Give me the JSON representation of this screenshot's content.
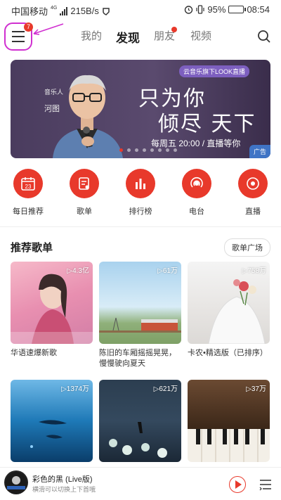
{
  "status_bar": {
    "carrier": "中国移动",
    "network": "4G",
    "speed": "215B/s",
    "battery": "95%",
    "time": "08:54"
  },
  "top_nav": {
    "menu_badge": "7",
    "tabs": [
      {
        "label": "我的"
      },
      {
        "label": "发现"
      },
      {
        "label": "朋友"
      },
      {
        "label": "视频"
      }
    ]
  },
  "banner": {
    "tag": "云音乐旗下LOOK直播",
    "host_role": "音乐人",
    "host_name": "河图",
    "line1": "只为你",
    "line2": "倾尽 天下",
    "schedule": "每周五 20:00 / 直播等你",
    "ad_label": "广告"
  },
  "categories": [
    {
      "label": "每日推荐",
      "icon": "calendar-icon",
      "day": "23"
    },
    {
      "label": "歌单",
      "icon": "playlist-icon"
    },
    {
      "label": "排行榜",
      "icon": "chart-icon"
    },
    {
      "label": "电台",
      "icon": "radio-icon"
    },
    {
      "label": "直播",
      "icon": "live-icon"
    }
  ],
  "recommend": {
    "title": "推荐歌单",
    "more_label": "歌单广场",
    "playlists": [
      {
        "plays": "▷4.3亿",
        "title": "华语速爆新歌"
      },
      {
        "plays": "▷61万",
        "title": "陈旧的车厢摇摇晃晃，慢慢驶向夏天"
      },
      {
        "plays": "▷758万",
        "title": "卡农•精选版（已排序）"
      },
      {
        "plays": "▷1374万",
        "title": ""
      },
      {
        "plays": "▷621万",
        "title": ""
      },
      {
        "plays": "▷37万",
        "title": ""
      }
    ]
  },
  "player": {
    "title": "彩色的黑 (Live版)",
    "subtitle": "横滑可以切换上下首哦"
  },
  "colors": {
    "accent": "#e8392b",
    "highlight_annotation": "#d02fd0"
  }
}
